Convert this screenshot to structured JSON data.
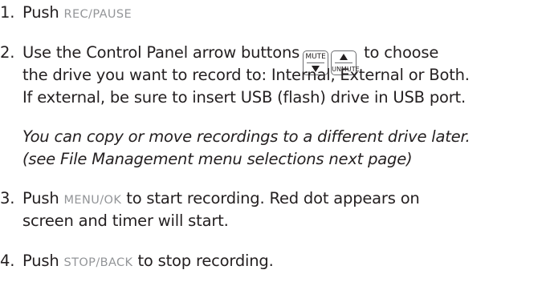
{
  "steps": [
    {
      "number": "1.",
      "text_before": "Push ",
      "key_label": "REC/PAUSE"
    },
    {
      "number": "2.",
      "line1_before": "Use the Control Panel arrow buttons",
      "line1_after": "to choose",
      "line2": "the drive you want to record to:  Internal, External or Both.",
      "line3": "If  external, be sure to insert USB (flash) drive in USB port.",
      "buttons": {
        "mute_label": "MUTE",
        "mute_icon": "arrow-down-icon",
        "unmute_label": "UNMUTE",
        "unmute_icon": "arrow-up-icon"
      },
      "note_line1": "You can copy or move recordings to a different drive later.",
      "note_line2": "(see File Management menu selections next page)"
    },
    {
      "number": "3.",
      "text_before": "Push ",
      "key_label": "MENU/OK",
      "line1_after": " to start recording. Red dot appears on",
      "line2": "screen and timer will start."
    },
    {
      "number": "4.",
      "text_before": "Push ",
      "key_label": "STOP/BACK",
      "line1_after": " to stop recording."
    }
  ],
  "colors": {
    "text": "#231f20",
    "key_label": "#939598",
    "button_border": "#6d6e71"
  }
}
